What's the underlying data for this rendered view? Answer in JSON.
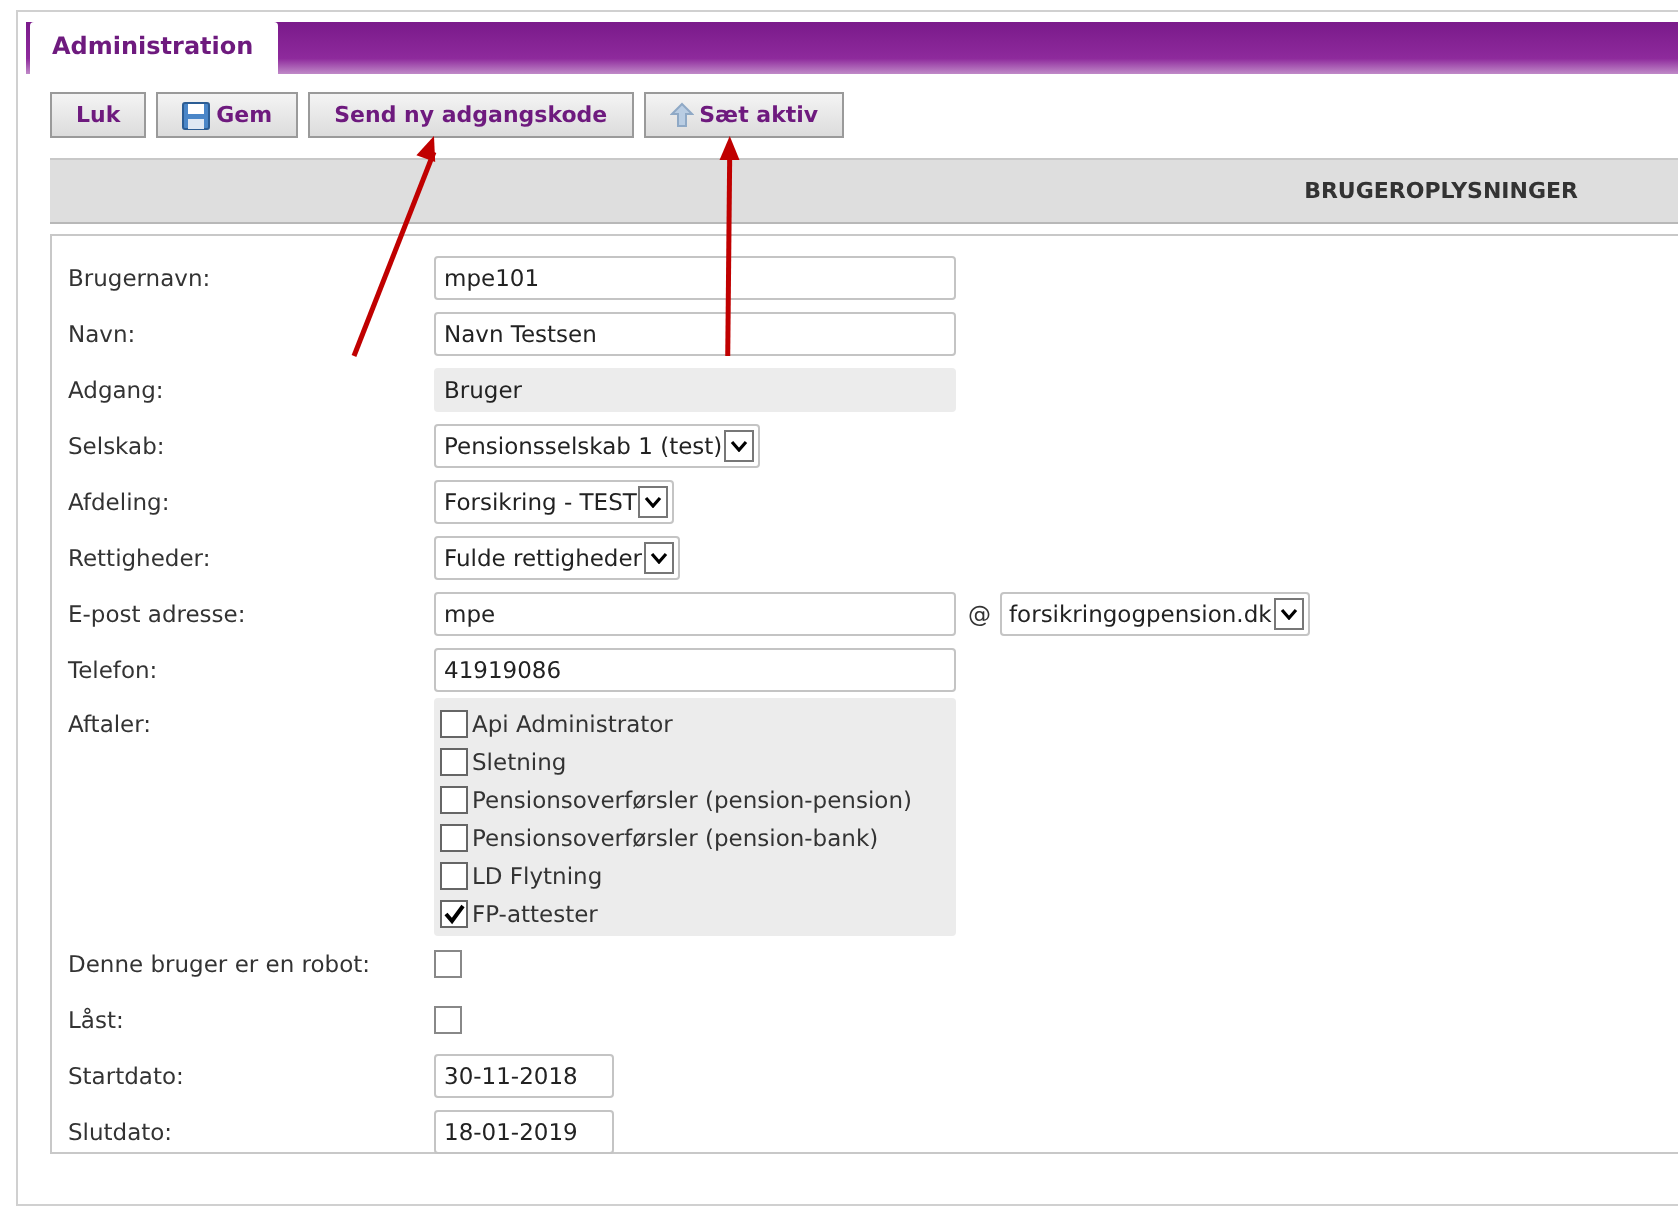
{
  "tabs": [
    {
      "label": "Administration",
      "selected": true
    }
  ],
  "toolbar": [
    {
      "label": "Luk",
      "kind": "plain",
      "annotated": false
    },
    {
      "label": "Gem",
      "kind": "save",
      "annotated": false
    },
    {
      "label": "Send ny adgangskode",
      "kind": "plain",
      "annotated": true
    },
    {
      "label": "Sæt aktiv",
      "kind": "activate",
      "annotated": true
    }
  ],
  "section_header": "BRUGEROPLYSNINGER",
  "fields": [
    {
      "label": "Brugernavn:",
      "kind": "text",
      "value": "mpe101"
    },
    {
      "label": "Navn:",
      "kind": "text",
      "value": "Navn Testsen"
    },
    {
      "label": "Adgang:",
      "kind": "readonly",
      "value": "Bruger"
    },
    {
      "label": "Selskab:",
      "kind": "select",
      "value": "Pensionsselskab 1 (test)"
    },
    {
      "label": "Afdeling:",
      "kind": "select",
      "value": "Forsikring - TEST"
    },
    {
      "label": "Rettigheder:",
      "kind": "select",
      "value": "Fulde rettigheder"
    },
    {
      "label": "E-post adresse:",
      "kind": "email",
      "value": "mpe",
      "separator": "@",
      "domain": "forsikringogpension.dk"
    },
    {
      "label": "Telefon:",
      "kind": "text",
      "value": "41919086"
    },
    {
      "label": "Aftaler:",
      "kind": "checklist",
      "options": [
        {
          "label": "Api Administrator",
          "checked": false
        },
        {
          "label": "Sletning",
          "checked": false
        },
        {
          "label": "Pensionsoverførsler (pension-pension)",
          "checked": false
        },
        {
          "label": "Pensionsoverførsler (pension-bank)",
          "checked": false
        },
        {
          "label": "LD Flytning",
          "checked": false
        },
        {
          "label": "FP-attester",
          "checked": true
        }
      ]
    },
    {
      "label": "Denne bruger er en robot:",
      "kind": "checkbox",
      "checked": false
    },
    {
      "label": "Låst:",
      "kind": "checkbox",
      "checked": false
    },
    {
      "label": "Startdato:",
      "kind": "date",
      "value": "30-11-2018"
    },
    {
      "label": "Slutdato:",
      "kind": "date",
      "value": "18-01-2019"
    }
  ]
}
